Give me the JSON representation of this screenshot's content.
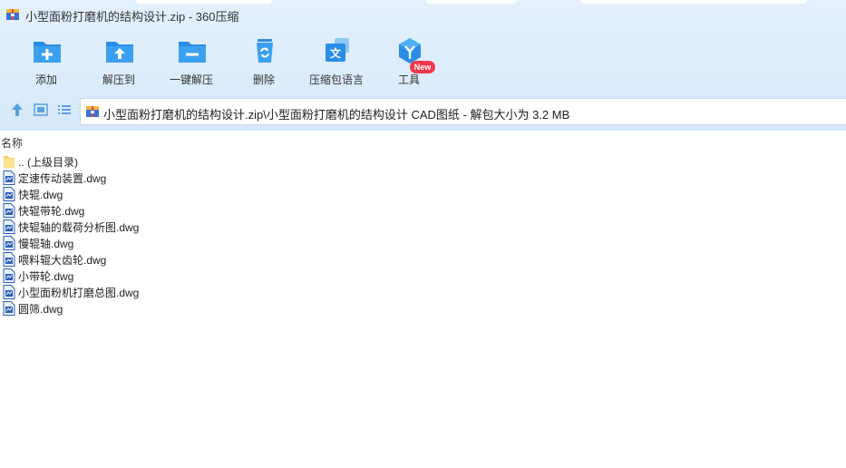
{
  "window": {
    "title": "小型面粉打磨机的结构设计.zip - 360压缩",
    "accent": "#2a8ee6"
  },
  "toolbar": {
    "items": [
      {
        "label": "添加",
        "icon": "add-folder-icon"
      },
      {
        "label": "解压到",
        "icon": "extract-to-icon"
      },
      {
        "label": "一键解压",
        "icon": "one-click-extract-icon"
      },
      {
        "label": "删除",
        "icon": "recycle-bin-icon"
      },
      {
        "label": "压缩包语言",
        "icon": "archive-language-icon"
      },
      {
        "label": "工具",
        "icon": "tools-icon"
      }
    ],
    "new_badge": "New"
  },
  "address": {
    "path": "小型面粉打磨机的结构设计.zip\\小型面粉打磨机的结构设计 CAD图纸 - 解包大小为 3.2 MB"
  },
  "list": {
    "column_name": "名称",
    "parent_label": ".. (上级目录)",
    "files": [
      "定速传动装置.dwg",
      "快辊.dwg",
      "快辊带轮.dwg",
      "快辊轴的载荷分析图.dwg",
      "慢辊轴.dwg",
      "喂料辊大齿轮.dwg",
      "小带轮.dwg",
      "小型面粉机打磨总图.dwg",
      "圆筛.dwg"
    ]
  }
}
